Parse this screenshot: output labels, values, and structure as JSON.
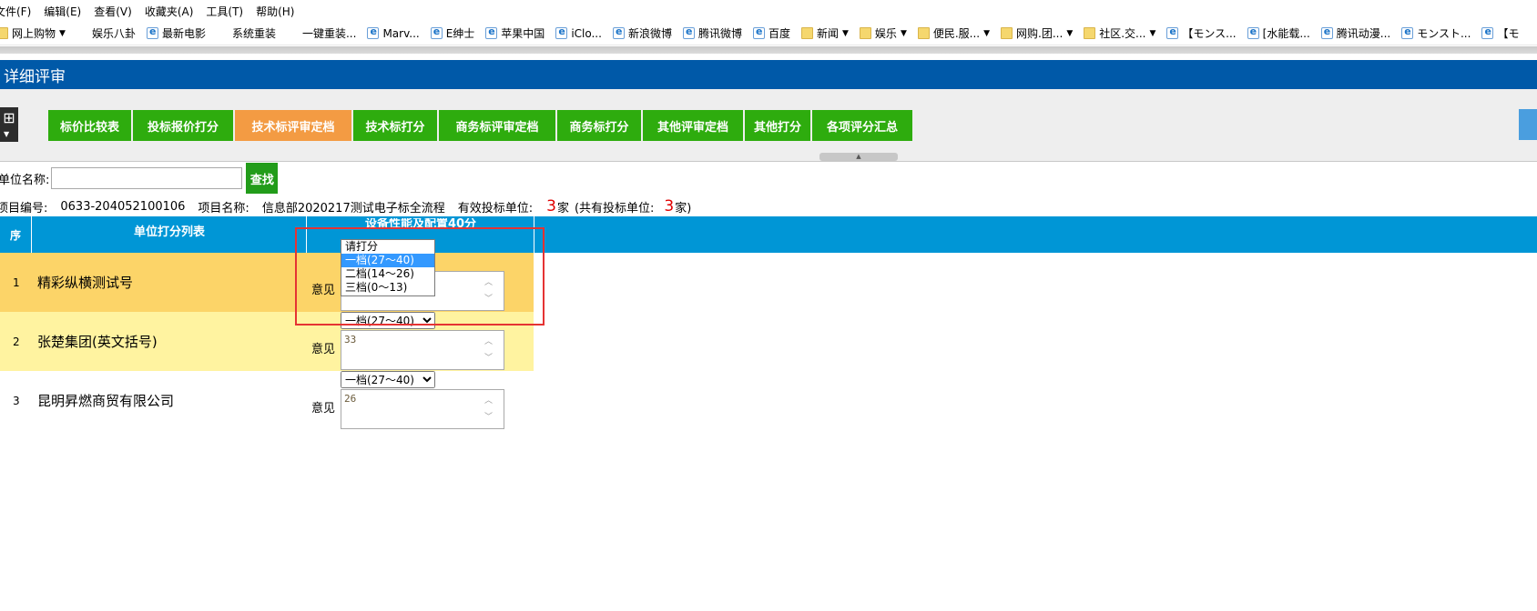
{
  "menubar": [
    "文件(F)",
    "编辑(E)",
    "查看(V)",
    "收藏夹(A)",
    "工具(T)",
    "帮助(H)"
  ],
  "favorites": [
    {
      "label": "网上购物",
      "icon": "folder-icon",
      "dropdown": true
    },
    {
      "label": "娱乐八卦",
      "icon": "none",
      "dropdown": false
    },
    {
      "label": "最新电影",
      "icon": "ie-page-icon",
      "dropdown": false
    },
    {
      "label": "系统重装",
      "icon": "none",
      "dropdown": false
    },
    {
      "label": "一键重装...",
      "icon": "none",
      "dropdown": false
    },
    {
      "label": "Marv...",
      "icon": "ie-page-icon",
      "dropdown": false
    },
    {
      "label": "E绅士",
      "icon": "ie-page-icon",
      "dropdown": false
    },
    {
      "label": "苹果中国",
      "icon": "ie-page-icon",
      "dropdown": false
    },
    {
      "label": "iClo...",
      "icon": "ie-page-icon",
      "dropdown": false
    },
    {
      "label": "新浪微博",
      "icon": "ie-page-icon",
      "dropdown": false
    },
    {
      "label": "腾讯微博",
      "icon": "ie-page-icon",
      "dropdown": false
    },
    {
      "label": "百度",
      "icon": "ie-page-icon",
      "dropdown": false
    },
    {
      "label": "新闻",
      "icon": "folder-icon",
      "dropdown": true
    },
    {
      "label": "娱乐",
      "icon": "folder-icon",
      "dropdown": true
    },
    {
      "label": "便民.服...",
      "icon": "folder-icon",
      "dropdown": true
    },
    {
      "label": "网购.团...",
      "icon": "folder-icon",
      "dropdown": true
    },
    {
      "label": "社区.交...",
      "icon": "folder-icon",
      "dropdown": true
    },
    {
      "label": "【モンス...",
      "icon": "ie-page-icon",
      "dropdown": false
    },
    {
      "label": "[水能载...",
      "icon": "ie-page-icon",
      "dropdown": false
    },
    {
      "label": "腾讯动漫...",
      "icon": "ie-page-icon",
      "dropdown": false
    },
    {
      "label": "モンスト...",
      "icon": "ie-page-icon",
      "dropdown": false
    },
    {
      "label": "【モ",
      "icon": "ie-page-icon",
      "dropdown": false
    }
  ],
  "title": "详细评审",
  "tabs": [
    {
      "label": "标价比较表",
      "active": false
    },
    {
      "label": "投标报价打分",
      "active": false
    },
    {
      "label": "技术标评审定档",
      "active": true
    },
    {
      "label": "技术标打分",
      "active": false
    },
    {
      "label": "商务标评审定档",
      "active": false
    },
    {
      "label": "商务标打分",
      "active": false
    },
    {
      "label": "其他评审定档",
      "active": false
    },
    {
      "label": "其他打分",
      "active": false
    },
    {
      "label": "各项评分汇总",
      "active": false
    }
  ],
  "search": {
    "label": "单位名称:",
    "value": "",
    "button": "查找"
  },
  "info": {
    "project_no_label": "项目编号:",
    "project_no": "0633-204052100106",
    "project_name_label": "项目名称:",
    "project_name": "信息部2020217测试电子标全流程",
    "valid_label": "有效投标单位:",
    "valid_count": "3",
    "valid_unit": "家",
    "total_prefix": "(共有投标单位:",
    "total_count": "3",
    "total_suffix": "家)"
  },
  "table": {
    "col_seq": "序",
    "col_list": "单位打分列表",
    "col_criterion": "设备性能及配置40分",
    "opinion_label": "意见",
    "rows": [
      {
        "seq": "1",
        "name": "精彩纵横测试号",
        "grade": "",
        "opinion": ""
      },
      {
        "seq": "2",
        "name": "张楚集团(英文括号)",
        "grade": "一档(27～40)",
        "opinion": "33"
      },
      {
        "seq": "3",
        "name": "昆明昇燃商贸有限公司",
        "grade": "一档(27～40)",
        "opinion": "26"
      }
    ]
  },
  "dropdown": {
    "options": [
      "请打分",
      "一档(27～40)",
      "二档(14～26)",
      "三档(0～13)"
    ],
    "highlighted": "一档(27～40)"
  },
  "colors": {
    "title_bar": "#0059a8",
    "tab_green": "#2eac0e",
    "tab_active": "#f39b43",
    "table_header": "#0096d6",
    "row1": "#fcd468",
    "row2": "#fff3a0",
    "highlight_box": "#e53333"
  }
}
